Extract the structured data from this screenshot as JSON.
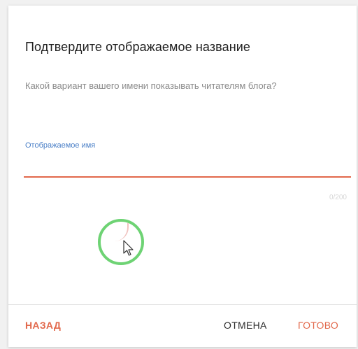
{
  "dialog": {
    "title": "Подтвердите отображаемое название",
    "description": "Какой вариант вашего имени показывать читателям блога?",
    "field": {
      "label": "Отображаемое имя",
      "value": "",
      "counter": "0/200"
    },
    "buttons": {
      "back": "НАЗАД",
      "cancel": "ОТМЕНА",
      "done": "ГОТОВО"
    }
  },
  "colors": {
    "accent": "#e2684b",
    "label": "#4a7fc7",
    "cursor_highlight": "#5fcf66"
  },
  "icons": {
    "cursor": "mouse-pointer-icon"
  }
}
